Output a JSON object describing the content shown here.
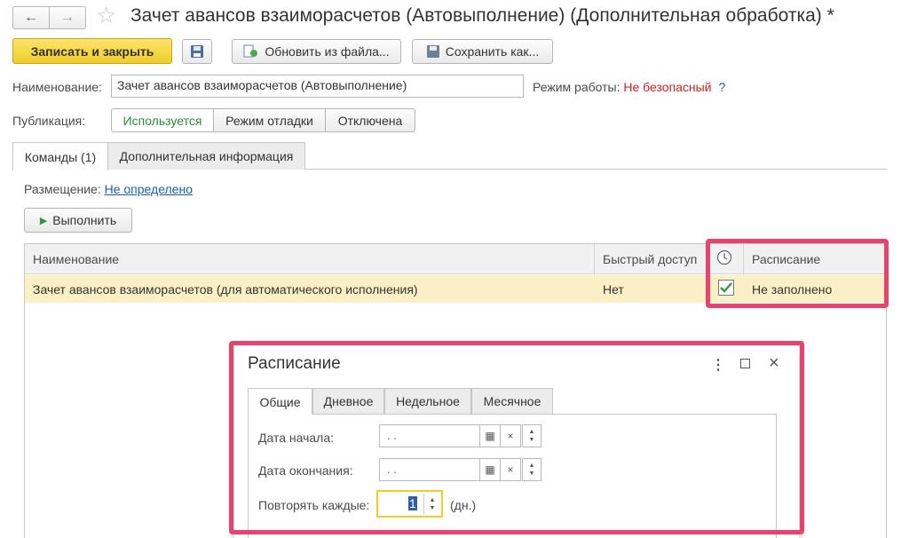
{
  "window": {
    "title": "Зачет авансов взаиморасчетов (Автовыполнение) (Дополнительная обработка) *",
    "back_icon": "arrow-left-icon",
    "forward_icon": "arrow-right-icon",
    "favorite_icon": "star-icon"
  },
  "toolbar": {
    "save_close": "Записать и закрыть",
    "disk_icon": "floppy-disk-icon",
    "update_from_file": "Обновить из файла...",
    "save_as": "Сохранить как..."
  },
  "form": {
    "name_label": "Наименование:",
    "name_value": "Зачет авансов взаиморасчетов (Автовыполнение)",
    "mode_label": "Режим работы:",
    "mode_value": "Не безопасный",
    "mode_help": "?",
    "publication_label": "Публикация:",
    "publication_options": [
      "Используется",
      "Режим отладки",
      "Отключена"
    ],
    "publication_selected": "Используется"
  },
  "tabs": [
    "Команды (1)",
    "Дополнительная информация"
  ],
  "commands": {
    "placement_label": "Размещение:",
    "placement_value": "Не определено",
    "run_button": "Выполнить",
    "columns": {
      "name": "Наименование",
      "quick_access": "Быстрый доступ",
      "clock_icon": "clock-icon",
      "schedule": "Расписание"
    },
    "rows": [
      {
        "name": "Зачет авансов взаиморасчетов (для автоматического исполнения)",
        "quick_access": "Нет",
        "scheduled": true,
        "schedule": "Не заполнено"
      }
    ]
  },
  "dialog": {
    "title": "Расписание",
    "tabs": [
      "Общие",
      "Дневное",
      "Недельное",
      "Месячное"
    ],
    "start_label": "Дата начала:",
    "start_value": " .  .",
    "end_label": "Дата окончания:",
    "end_value": " .  .",
    "repeat_label": "Повторять каждые:",
    "repeat_value": "1",
    "repeat_unit": "(дн.)"
  },
  "colors": {
    "accent_yellow": "#f5d335",
    "highlight_pink": "#e8436e",
    "selected_row": "#fbf0c5",
    "link_blue": "#1a5fb4",
    "danger_red": "#d42020"
  }
}
